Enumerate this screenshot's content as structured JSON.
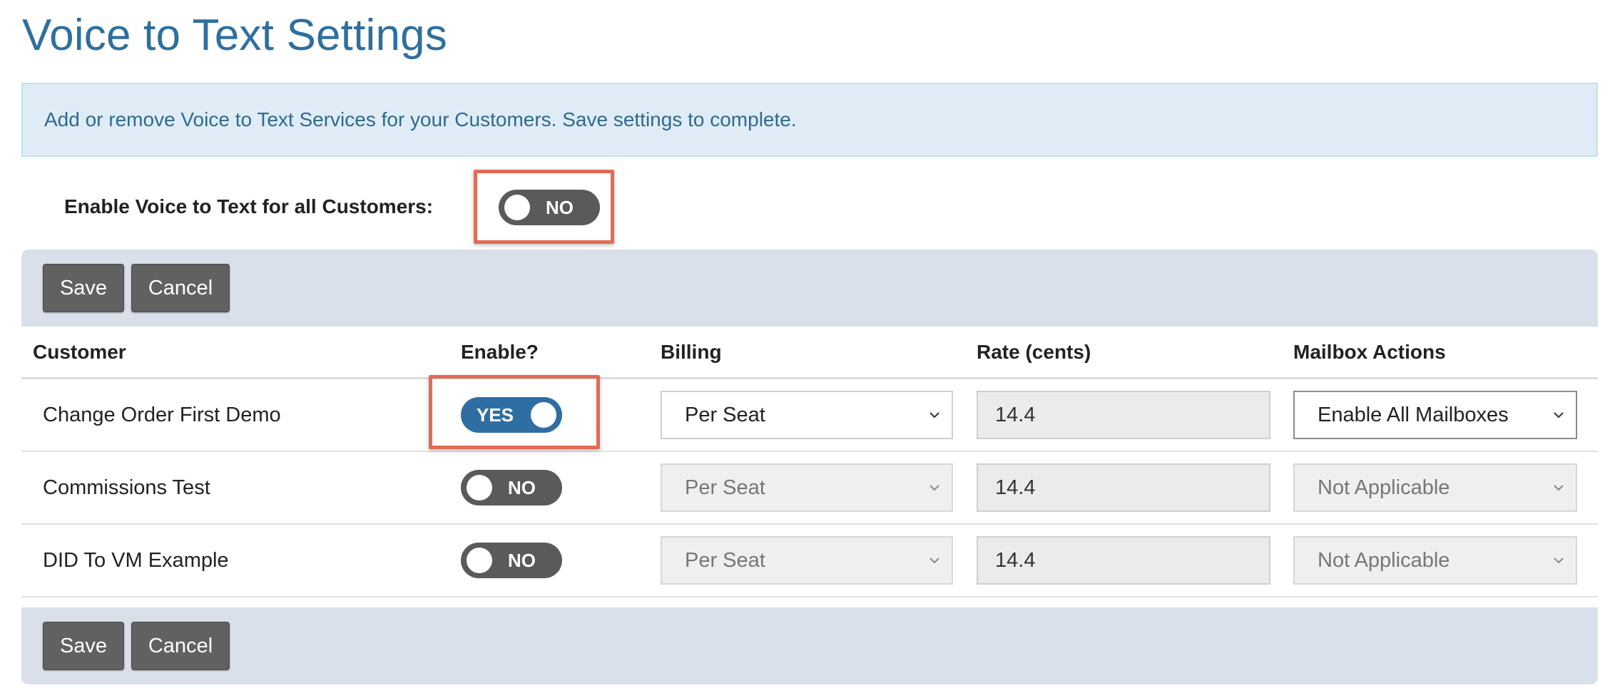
{
  "page": {
    "title": "Voice to Text Settings",
    "banner": "Add or remove Voice to Text Services for your Customers. Save settings to complete."
  },
  "global": {
    "label": "Enable Voice to Text for all Customers:",
    "toggle_text": "NO",
    "toggle_state": false
  },
  "actions": {
    "save_label": "Save",
    "cancel_label": "Cancel"
  },
  "table": {
    "headers": {
      "customer": "Customer",
      "enable": "Enable?",
      "billing": "Billing",
      "rate": "Rate (cents)",
      "mailbox": "Mailbox Actions"
    },
    "rows": [
      {
        "customer": "Change Order First Demo",
        "enabled": true,
        "toggle_text": "YES",
        "billing": "Per Seat",
        "rate": "14.4",
        "mailbox": "Enable All Mailboxes"
      },
      {
        "customer": "Commissions Test",
        "enabled": false,
        "toggle_text": "NO",
        "billing": "Per Seat",
        "rate": "14.4",
        "mailbox": "Not Applicable"
      },
      {
        "customer": "DID To VM Example",
        "enabled": false,
        "toggle_text": "NO",
        "billing": "Per Seat",
        "rate": "14.4",
        "mailbox": "Not Applicable"
      }
    ]
  },
  "colors": {
    "title": "#2e6f9e",
    "banner_bg": "#dfecf6",
    "toggle_on": "#2f6ea3",
    "toggle_off": "#5a5a5a",
    "highlight": "#e26b55",
    "button": "#616161",
    "action_bar": "#d9e0ea"
  },
  "icons": {
    "select_arrow": "chevron-down-icon"
  }
}
